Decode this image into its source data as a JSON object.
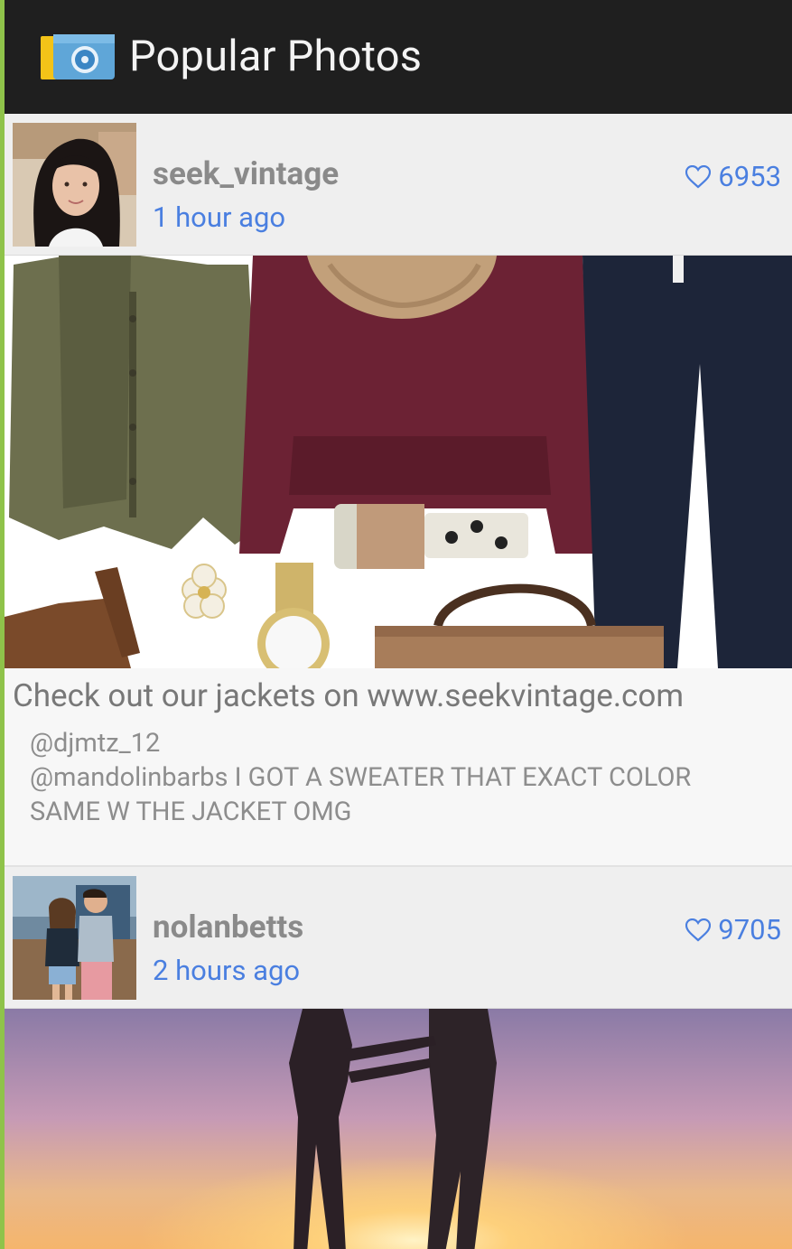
{
  "app_bar": {
    "title": "Popular Photos",
    "icon": "camera-app-icon"
  },
  "posts": [
    {
      "username": "seek_vintage",
      "time_ago": "1 hour ago",
      "likes": "6953",
      "caption": "Check out our jackets on www.seekvintage.com",
      "comments": [
        {
          "text": "@djmtz_12"
        },
        {
          "text": "@mandolinbarbs I GOT A SWEATER THAT EXACT COLOR SAME W THE JACKET OMG"
        }
      ]
    },
    {
      "username": "nolanbetts",
      "time_ago": "2 hours ago",
      "likes": "9705"
    }
  ],
  "colors": {
    "app_bar_bg": "#1f1f1f",
    "accent_blue": "#4a7fe0",
    "username_gray": "#8a8a8a",
    "edge_green": "#8fc34a"
  }
}
